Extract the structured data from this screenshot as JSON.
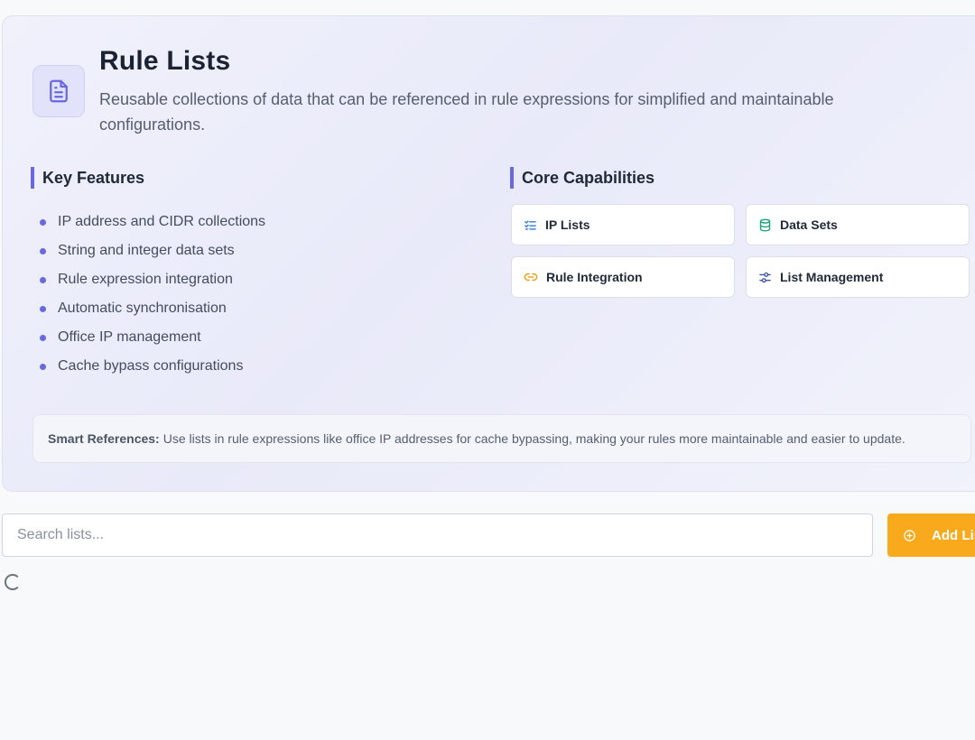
{
  "header": {
    "title": "Rule Lists",
    "description": "Reusable collections of data that can be referenced in rule expressions for simplified and maintainable configurations.",
    "icon": "document-icon"
  },
  "key_features": {
    "heading": "Key Features",
    "items": [
      "IP address and CIDR collections",
      "String and integer data sets",
      "Rule expression integration",
      "Automatic synchronisation",
      "Office IP management",
      "Cache bypass configurations"
    ]
  },
  "core_capabilities": {
    "heading": "Core Capabilities",
    "items": [
      {
        "label": "IP Lists",
        "icon": "list-check-icon",
        "color": "#2b7bd9"
      },
      {
        "label": "Data Sets",
        "icon": "database-icon",
        "color": "#1aa37a"
      },
      {
        "label": "Rule Integration",
        "icon": "link-icon",
        "color": "#e6a117"
      },
      {
        "label": "List Management",
        "icon": "sliders-icon",
        "color": "#4058a8"
      }
    ]
  },
  "smart_references": {
    "label": "Smart References:",
    "text": "Use lists in rule expressions like office IP addresses for cache bypassing, making your rules more maintainable and easier to update."
  },
  "search": {
    "placeholder": "Search lists...",
    "value": ""
  },
  "add_button": {
    "label": "Add List",
    "icon": "plus-circle-icon"
  },
  "colors": {
    "accent": "#6a68e0",
    "add_button": "#f8a91c"
  }
}
